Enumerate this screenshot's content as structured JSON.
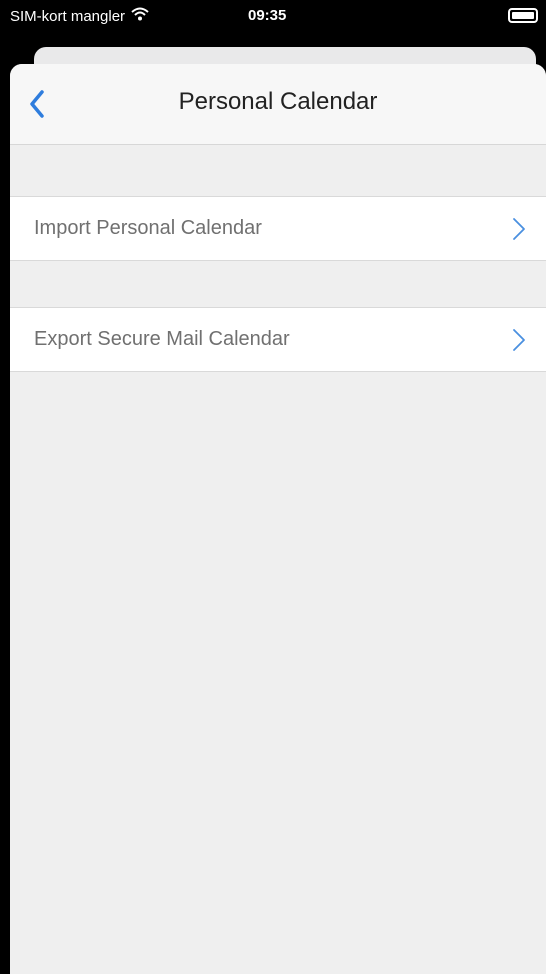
{
  "status_bar": {
    "carrier": "SIM-kort mangler",
    "time": "09:35"
  },
  "nav": {
    "title": "Personal Calendar",
    "back_icon": "chevron-left-icon",
    "accent": "#2f7ddd"
  },
  "rows": [
    {
      "label": "Import Personal Calendar"
    },
    {
      "label": "Export Secure Mail Calendar"
    }
  ],
  "colors": {
    "chevron": "#4a8fe0",
    "background": "#efefef"
  }
}
